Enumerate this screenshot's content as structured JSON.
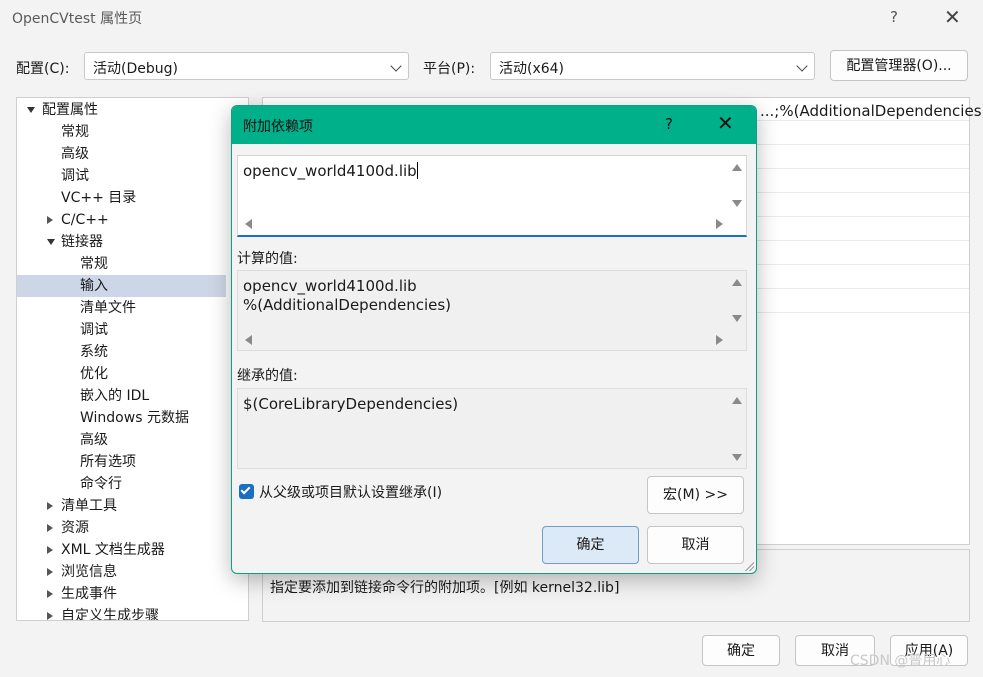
{
  "window": {
    "title": "OpenCVtest 属性页",
    "help_glyph": "?",
    "close_glyph": "✕"
  },
  "config_bar": {
    "config_label": "配置(C):",
    "config_value": "活动(Debug)",
    "platform_label": "平台(P):",
    "platform_value": "活动(x64)",
    "config_manager_label": "配置管理器(O)..."
  },
  "tree": {
    "items": [
      {
        "label": "配置属性",
        "level": 0,
        "expander": "expanded"
      },
      {
        "label": "常规",
        "level": 1,
        "expander": "none"
      },
      {
        "label": "高级",
        "level": 1,
        "expander": "none"
      },
      {
        "label": "调试",
        "level": 1,
        "expander": "none"
      },
      {
        "label": "VC++ 目录",
        "level": 1,
        "expander": "none"
      },
      {
        "label": "C/C++",
        "level": 1,
        "expander": "collapsed"
      },
      {
        "label": "链接器",
        "level": 1,
        "expander": "expanded"
      },
      {
        "label": "常规",
        "level": 2,
        "expander": "none"
      },
      {
        "label": "输入",
        "level": 2,
        "expander": "none",
        "selected": true
      },
      {
        "label": "清单文件",
        "level": 2,
        "expander": "none"
      },
      {
        "label": "调试",
        "level": 2,
        "expander": "none"
      },
      {
        "label": "系统",
        "level": 2,
        "expander": "none"
      },
      {
        "label": "优化",
        "level": 2,
        "expander": "none"
      },
      {
        "label": "嵌入的 IDL",
        "level": 2,
        "expander": "none"
      },
      {
        "label": "Windows 元数据",
        "level": 2,
        "expander": "none"
      },
      {
        "label": "高级",
        "level": 2,
        "expander": "none"
      },
      {
        "label": "所有选项",
        "level": 2,
        "expander": "none"
      },
      {
        "label": "命令行",
        "level": 2,
        "expander": "none"
      },
      {
        "label": "清单工具",
        "level": 1,
        "expander": "collapsed"
      },
      {
        "label": "资源",
        "level": 1,
        "expander": "collapsed"
      },
      {
        "label": "XML 文档生成器",
        "level": 1,
        "expander": "collapsed"
      },
      {
        "label": "浏览信息",
        "level": 1,
        "expander": "collapsed"
      },
      {
        "label": "生成事件",
        "level": 1,
        "expander": "collapsed"
      },
      {
        "label": "自定义生成步骤",
        "level": 1,
        "expander": "collapsed"
      }
    ]
  },
  "property_grid": {
    "visible_value": "...;%(AdditionalDependencies)"
  },
  "description": {
    "text": "指定要添加到链接命令行的附加项。[例如 kernel32.lib]"
  },
  "footer": {
    "ok_label": "确定",
    "cancel_label": "取消",
    "apply_label": "应用(A)"
  },
  "dialog": {
    "title": "附加依赖项",
    "help_glyph": "?",
    "close_glyph": "✕",
    "edit_value": "opencv_world4100d.lib",
    "computed_label": "计算的值:",
    "computed_value": "opencv_world4100d.lib\n%(AdditionalDependencies)",
    "inherited_label": "继承的值:",
    "inherited_value": "$(CoreLibraryDependencies)",
    "inherit_checkbox_label": "从父级或项目默认设置继承(I)",
    "inherit_checked": true,
    "macro_button_label": "宏(M) >>",
    "ok_label": "确定",
    "cancel_label": "取消"
  },
  "watermark": {
    "text": "CSDN @普用心"
  },
  "colors": {
    "dialog_title_bar": "#00b08b",
    "selection": "#cdd6e6",
    "accent_blue": "#1b6fbe",
    "primary_button": "#dce9f6"
  }
}
